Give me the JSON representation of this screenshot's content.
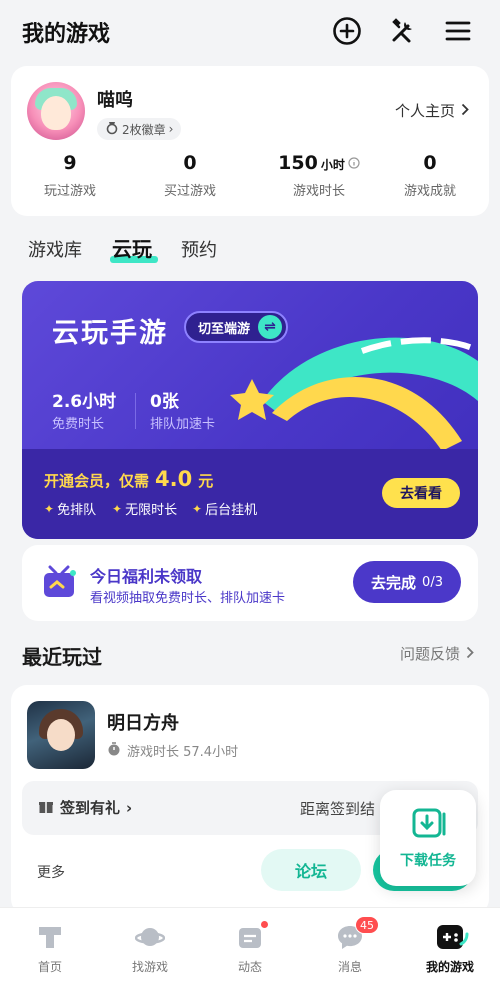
{
  "header": {
    "title": "我的游戏"
  },
  "profile": {
    "username": "喵呜",
    "badges": "2枚徽章",
    "homepage_link": "个人主页",
    "stats": [
      {
        "value": "9",
        "unit": "",
        "label": "玩过游戏"
      },
      {
        "value": "0",
        "unit": "",
        "label": "买过游戏"
      },
      {
        "value": "150",
        "unit": "小时",
        "label": "游戏时长"
      },
      {
        "value": "0",
        "unit": "",
        "label": "游戏成就"
      }
    ]
  },
  "tabs": [
    {
      "label": "游戏库",
      "active": false
    },
    {
      "label": "云玩",
      "active": true
    },
    {
      "label": "预约",
      "active": false
    }
  ],
  "cloud_promo": {
    "title": "云玩手游",
    "switch_label": "切至端游",
    "stats": [
      {
        "value": "2.6小时",
        "label": "免费时长"
      },
      {
        "value": "0张",
        "label": "排队加速卡"
      }
    ],
    "vip_text": "开通会员，仅需",
    "vip_price": "4.0",
    "vip_unit": "元",
    "perks": [
      "免排队",
      "无限时长",
      "后台挂机"
    ],
    "cta": "去看看"
  },
  "welfare": {
    "title": "今日福利未领取",
    "subtitle": "看视频抽取免费时长、排队加速卡",
    "button_label": "去完成",
    "progress": "0/3"
  },
  "recent": {
    "title": "最近玩过",
    "feedback": "问题反馈",
    "game": {
      "name": "明日方舟",
      "playtime": "游戏时长 57.4小时",
      "checkin": "签到有礼",
      "checkin_distance": "距离签到结",
      "more": "更多",
      "forum": "论坛"
    }
  },
  "download_task": {
    "label": "下载任务"
  },
  "bottom_nav": [
    {
      "label": "首页",
      "icon": "home-icon"
    },
    {
      "label": "找游戏",
      "icon": "planet-icon"
    },
    {
      "label": "动态",
      "icon": "feed-icon"
    },
    {
      "label": "消息",
      "icon": "message-icon",
      "badge": "45"
    },
    {
      "label": "我的游戏",
      "icon": "gamepad-icon",
      "active": true
    }
  ],
  "colors": {
    "brand_purple": "#4a37c8",
    "accent_teal": "#3ee6c6",
    "accent_yellow": "#ffd84d",
    "badge_red": "#ff4d4f"
  }
}
